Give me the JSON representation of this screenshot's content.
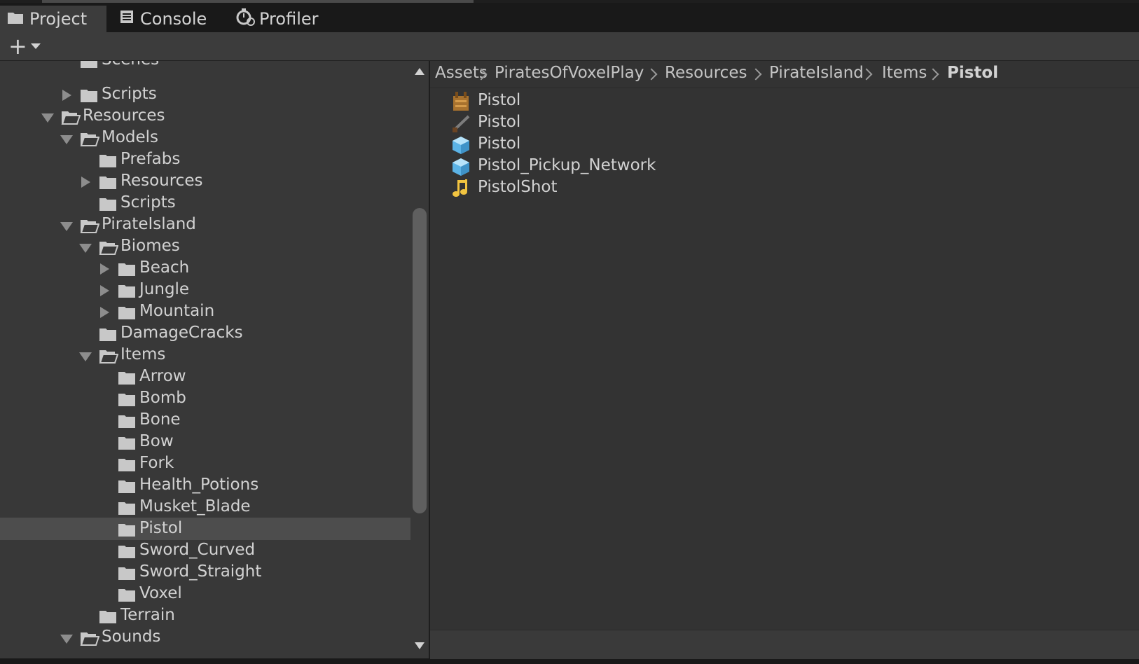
{
  "tabs": [
    {
      "label": "Project",
      "icon": "folder-icon",
      "active": true
    },
    {
      "label": "Console",
      "icon": "console-icon",
      "active": false
    },
    {
      "label": "Profiler",
      "icon": "profiler-icon",
      "active": false
    }
  ],
  "toolbar": {
    "create_icon": "plus-icon",
    "dropdown_icon": "dropdown-arrow-icon"
  },
  "tree": {
    "items": [
      {
        "label": "Scenes"
      },
      {
        "label": "Scripts"
      },
      {
        "label": "Resources"
      },
      {
        "label": "Models"
      },
      {
        "label": "Prefabs"
      },
      {
        "label": "Resources"
      },
      {
        "label": "Scripts"
      },
      {
        "label": "PirateIsland"
      },
      {
        "label": "Biomes"
      },
      {
        "label": "Beach"
      },
      {
        "label": "Jungle"
      },
      {
        "label": "Mountain"
      },
      {
        "label": "DamageCracks"
      },
      {
        "label": "Items"
      },
      {
        "label": "Arrow"
      },
      {
        "label": "Bomb"
      },
      {
        "label": "Bone"
      },
      {
        "label": "Bow"
      },
      {
        "label": "Fork"
      },
      {
        "label": "Health_Potions"
      },
      {
        "label": "Musket_Blade"
      },
      {
        "label": "Pistol",
        "selected": true
      },
      {
        "label": "Sword_Curved"
      },
      {
        "label": "Sword_Straight"
      },
      {
        "label": "Voxel"
      },
      {
        "label": "Terrain"
      },
      {
        "label": "Sounds"
      }
    ]
  },
  "breadcrumb": [
    "Assets",
    "PiratesOfVoxelPlay",
    "Resources",
    "PirateIsland",
    "Items",
    "Pistol"
  ],
  "assets": [
    {
      "label": "Pistol",
      "icon": "texture-icon"
    },
    {
      "label": "Pistol",
      "icon": "model-icon"
    },
    {
      "label": "Pistol",
      "icon": "prefab-icon"
    },
    {
      "label": "Pistol_Pickup_Network",
      "icon": "prefab-icon"
    },
    {
      "label": "PistolShot",
      "icon": "audio-icon"
    }
  ],
  "colors": {
    "panel": "#383838",
    "selection": "#4d4d4d",
    "prefab_blue": "#8fd0f5",
    "audio_yellow": "#f2c440"
  }
}
